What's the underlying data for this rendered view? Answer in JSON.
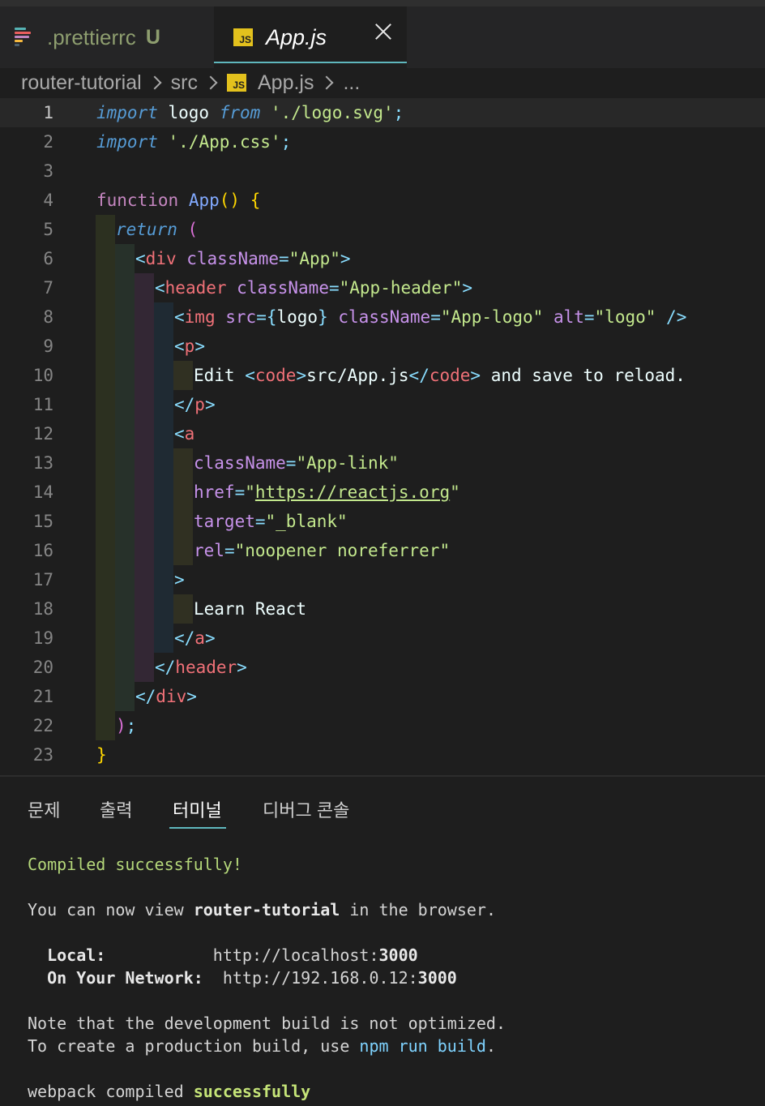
{
  "tabs": {
    "inactive": {
      "label": ".prettierrc",
      "status": "U"
    },
    "active": {
      "icon_text": "JS",
      "label": "App.js"
    }
  },
  "breadcrumb": {
    "items": [
      "router-tutorial",
      "src",
      "App.js",
      "..."
    ],
    "icon_text": "JS"
  },
  "editor": {
    "line_numbers": [
      "1",
      "2",
      "3",
      "4",
      "5",
      "6",
      "7",
      "8",
      "9",
      "10",
      "11",
      "12",
      "13",
      "14",
      "15",
      "16",
      "17",
      "18",
      "19",
      "20",
      "21",
      "22",
      "23"
    ],
    "tokens": {
      "l1": [
        "import",
        " logo ",
        "from",
        " ",
        "'./logo.svg'",
        ";"
      ],
      "l2": [
        "import",
        " ",
        "'./App.css'",
        ";"
      ],
      "l4": [
        "function",
        " ",
        "App",
        "(",
        ")",
        " ",
        "{"
      ],
      "l5": [
        "return",
        " ",
        "("
      ],
      "l6": [
        "<",
        "div",
        " ",
        "className",
        "=",
        "\"App\"",
        ">"
      ],
      "l7": [
        "<",
        "header",
        " ",
        "className",
        "=",
        "\"App-header\"",
        ">"
      ],
      "l8": [
        "<",
        "img",
        " ",
        "src",
        "=",
        "{",
        "logo",
        "}",
        " ",
        "className",
        "=",
        "\"App-logo\"",
        " ",
        "alt",
        "=",
        "\"logo\"",
        " ",
        "/>"
      ],
      "l9": [
        "<",
        "p",
        ">"
      ],
      "l10": [
        "Edit ",
        "<",
        "code",
        ">",
        "src/App.js",
        "</",
        "code",
        ">",
        " and save to reload."
      ],
      "l11": [
        "</",
        "p",
        ">"
      ],
      "l12": [
        "<",
        "a"
      ],
      "l13": [
        "className",
        "=",
        "\"App-link\""
      ],
      "l14": [
        "href",
        "=",
        "\"",
        "https://reactjs.org",
        "\""
      ],
      "l15": [
        "target",
        "=",
        "\"_blank\""
      ],
      "l16": [
        "rel",
        "=",
        "\"noopener noreferrer\""
      ],
      "l17": [
        ">"
      ],
      "l18": [
        "Learn React"
      ],
      "l19": [
        "</",
        "a",
        ">"
      ],
      "l20": [
        "</",
        "header",
        ">"
      ],
      "l21": [
        "</",
        "div",
        ">"
      ],
      "l22": [
        ")",
        ";"
      ],
      "l23": [
        "}"
      ]
    }
  },
  "panel": {
    "tabs": [
      "문제",
      "출력",
      "터미널",
      "디버그 콘솔"
    ],
    "active_tab": "터미널"
  },
  "terminal": {
    "compiled": "Compiled successfully!",
    "view_prefix": "You can now view ",
    "project": "router-tutorial",
    "view_suffix": " in the browser.",
    "local_label": "Local:",
    "local_url_prefix": "http://localhost:",
    "local_port": "3000",
    "network_label": "On Your Network:",
    "network_url_prefix": "http://192.168.0.12:",
    "network_port": "3000",
    "note": "Note that the development build is not optimized.",
    "create_prefix": "To create a production build, use ",
    "create_cmd": "npm run build",
    "create_suffix": ".",
    "webpack_prefix": "webpack compiled ",
    "webpack_status": "successfully"
  },
  "colors": {
    "accent": "#5fb7bd",
    "js_badge": "#e3c11d",
    "editor_bg": "#1e1e1e"
  }
}
